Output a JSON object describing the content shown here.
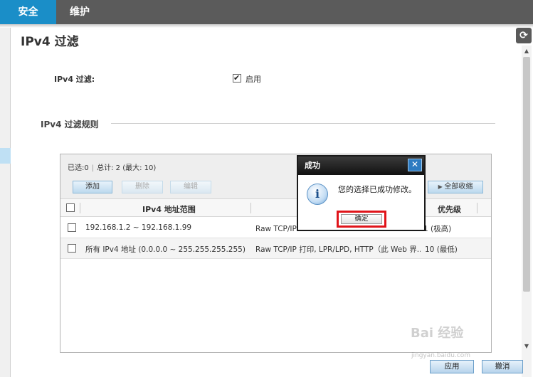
{
  "tabs": [
    {
      "label": "安全",
      "active": true
    },
    {
      "label": "维护",
      "active": false
    }
  ],
  "page": {
    "title": "IPv4 过滤",
    "filter_label": "IPv4 过滤:",
    "enable_label": "启用",
    "enable_checked": true,
    "rules_title": "IPv4 过滤规则"
  },
  "table": {
    "selected_label": "已选:",
    "selected_count": "0",
    "total_label": "总计: 2 (最大: 10)",
    "buttons": {
      "add": "添加",
      "delete": "删除",
      "edit": "编辑",
      "collapse_all": "全部收缩"
    },
    "columns": [
      "IPv4 地址范围",
      "",
      "优先级"
    ],
    "rows": [
      {
        "range": "192.168.1.2 ~ 192.168.1.99",
        "protocol": "Raw TCP/IP 打",
        "priority": "1 (极高)"
      },
      {
        "range": "所有 IPv4 地址 (0.0.0.0 ~ 255.255.255.255)",
        "protocol": "Raw TCP/IP 打印, LPR/LPD, HTTP（此 Web 界...",
        "priority": "10 (最低)"
      }
    ]
  },
  "footer": {
    "apply": "应用",
    "cancel": "撤消"
  },
  "dialog": {
    "title": "成功",
    "close_glyph": "✕",
    "message": "您的选择已成功修改。",
    "ok_label": "确定"
  },
  "watermark": {
    "text": "Bai 经验",
    "sub": "jingyan.baidu.com"
  },
  "colors": {
    "tab_active": "#1a8ec8",
    "topbar": "#5b5b5b",
    "highlight_border": "#e0141a"
  }
}
